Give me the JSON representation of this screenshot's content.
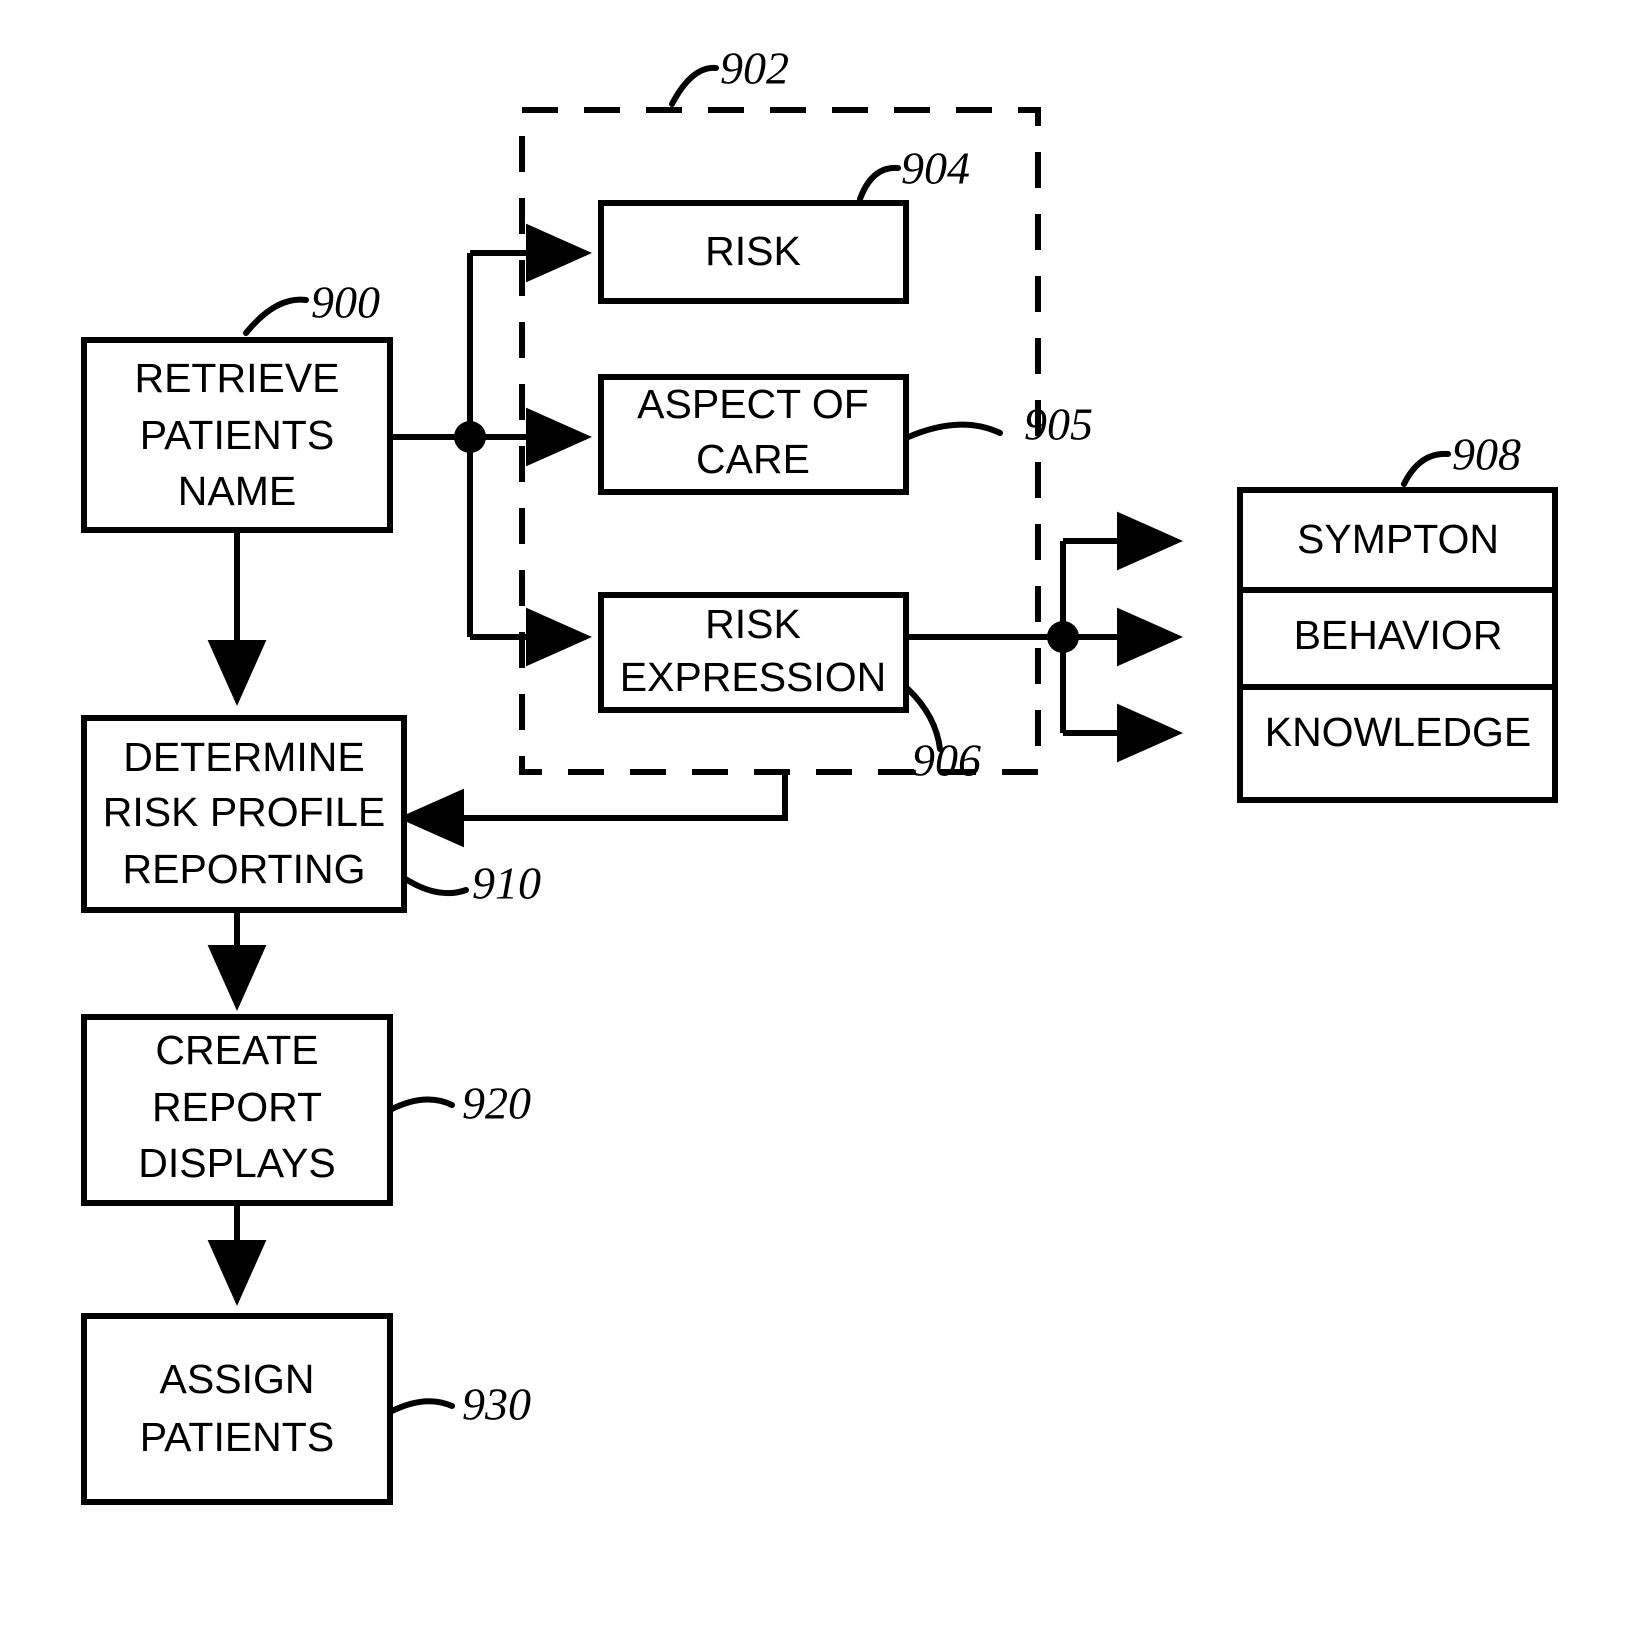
{
  "figure": {
    "title": "Risk profile reporting flowchart",
    "background_color": "#ffffff",
    "line_color": "#000000"
  },
  "process_boxes": [
    {
      "id": "retrieve-patients-name",
      "ref": "900",
      "lines": [
        "RETRIEVE",
        "PATIENTS",
        "NAME"
      ]
    },
    {
      "id": "determine-risk-profile-reporting",
      "ref": "910",
      "lines": [
        "DETERMINE",
        "RISK PROFILE",
        "REPORTING"
      ]
    },
    {
      "id": "create-report-displays",
      "ref": "920",
      "lines": [
        "CREATE",
        "REPORT",
        "DISPLAYS"
      ]
    },
    {
      "id": "assign-patients",
      "ref": "930",
      "lines": [
        "ASSIGN",
        "PATIENTS"
      ]
    }
  ],
  "grouped_region": {
    "id": "risk-profile-group",
    "ref": "902",
    "style": "dashed",
    "members": [
      {
        "id": "risk",
        "ref": "904",
        "lines": [
          "RISK"
        ]
      },
      {
        "id": "aspect-of-care",
        "ref": "905",
        "lines": [
          "ASPECT OF",
          "CARE"
        ]
      },
      {
        "id": "risk-expression",
        "ref": "906",
        "lines": [
          "RISK",
          "EXPRESSION"
        ]
      }
    ]
  },
  "stacked_box": {
    "id": "risk-expression-types",
    "ref": "908",
    "rows": [
      "SYMPTON",
      "BEHAVIOR",
      "KNOWLEDGE"
    ]
  },
  "text": {
    "b900_l1": "RETRIEVE",
    "b900_l2": "PATIENTS",
    "b900_l3": "NAME",
    "b910_l1": "DETERMINE",
    "b910_l2": "RISK PROFILE",
    "b910_l3": "REPORTING",
    "b920_l1": "CREATE",
    "b920_l2": "REPORT",
    "b920_l3": "DISPLAYS",
    "b930_l1": "ASSIGN",
    "b930_l2": "PATIENTS",
    "b904_l1": "RISK",
    "b905_l1": "ASPECT OF",
    "b905_l2": "CARE",
    "b906_l1": "RISK",
    "b906_l2": "EXPRESSION",
    "b908_r1": "SYMPTON",
    "b908_r2": "BEHAVIOR",
    "b908_r3": "KNOWLEDGE",
    "ref900": "900",
    "ref902": "902",
    "ref904": "904",
    "ref905": "905",
    "ref906": "906",
    "ref908": "908",
    "ref910": "910",
    "ref920": "920",
    "ref930": "930"
  }
}
